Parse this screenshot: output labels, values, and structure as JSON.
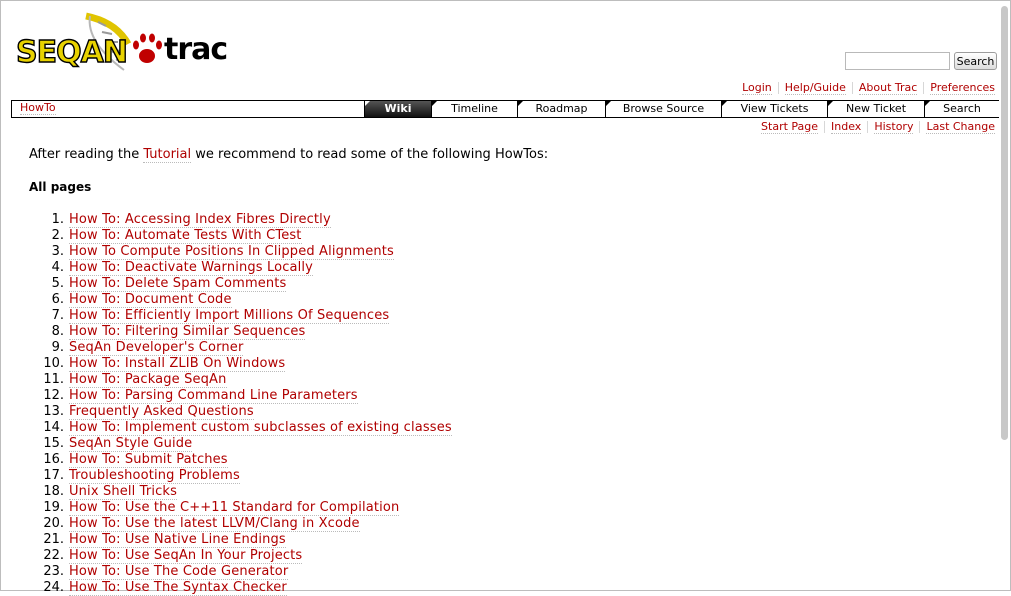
{
  "logo": {
    "text_left": "SEQAN",
    "text_right": "trac",
    "colors": {
      "seqan": "#e8d200",
      "trac": "#000000",
      "paw": "#c00000"
    }
  },
  "search": {
    "input_value": "",
    "button_label": "Search"
  },
  "metanav": [
    "Login",
    "Help/Guide",
    "About Trac",
    "Preferences"
  ],
  "mainnav": {
    "breadcrumb": "HowTo",
    "tabs": [
      "Wiki",
      "Timeline",
      "Roadmap",
      "Browse Source",
      "View Tickets",
      "New Ticket",
      "Search"
    ],
    "active_tab": "Wiki"
  },
  "ctxnav": [
    "Start Page",
    "Index",
    "History",
    "Last Change"
  ],
  "content": {
    "intro_before": "After reading the ",
    "intro_link": "Tutorial",
    "intro_after": " we recommend to read some of the following HowTos:",
    "section_title": "All pages",
    "items": [
      {
        "num": "1.",
        "label": "How To: Accessing Index Fibres Directly"
      },
      {
        "num": "2.",
        "label": "How To: Automate Tests With CTest"
      },
      {
        "num": "3.",
        "label": "How To Compute Positions In Clipped Alignments"
      },
      {
        "num": "4.",
        "label": "How To: Deactivate Warnings Locally"
      },
      {
        "num": "5.",
        "label": "How To: Delete Spam Comments"
      },
      {
        "num": "6.",
        "label": "How To: Document Code"
      },
      {
        "num": "7.",
        "label": "How To: Efficiently Import Millions Of Sequences"
      },
      {
        "num": "8.",
        "label": "How To: Filtering Similar Sequences"
      },
      {
        "num": "9.",
        "label": "SeqAn Developer's Corner"
      },
      {
        "num": "10.",
        "label": "How To: Install ZLIB On Windows"
      },
      {
        "num": "11.",
        "label": "How To: Package SeqAn"
      },
      {
        "num": "12.",
        "label": "How To: Parsing Command Line Parameters"
      },
      {
        "num": "13.",
        "label": "Frequently Asked Questions"
      },
      {
        "num": "14.",
        "label": "How To: Implement custom subclasses of existing classes"
      },
      {
        "num": "15.",
        "label": "SeqAn Style Guide"
      },
      {
        "num": "16.",
        "label": "How To: Submit Patches"
      },
      {
        "num": "17.",
        "label": "Troubleshooting Problems"
      },
      {
        "num": "18.",
        "label": "Unix Shell Tricks"
      },
      {
        "num": "19.",
        "label": "How To: Use the C++11 Standard for Compilation"
      },
      {
        "num": "20.",
        "label": "How To: Use the latest LLVM/Clang in Xcode"
      },
      {
        "num": "21.",
        "label": "How To: Use Native Line Endings"
      },
      {
        "num": "22.",
        "label": "How To: Use SeqAn In Your Projects"
      },
      {
        "num": "23.",
        "label": "How To: Use The Code Generator"
      },
      {
        "num": "24.",
        "label": "How To: Use The Syntax Checker"
      }
    ]
  },
  "colors": {
    "link": "#b00000",
    "active_tab_bg": "#222222"
  }
}
